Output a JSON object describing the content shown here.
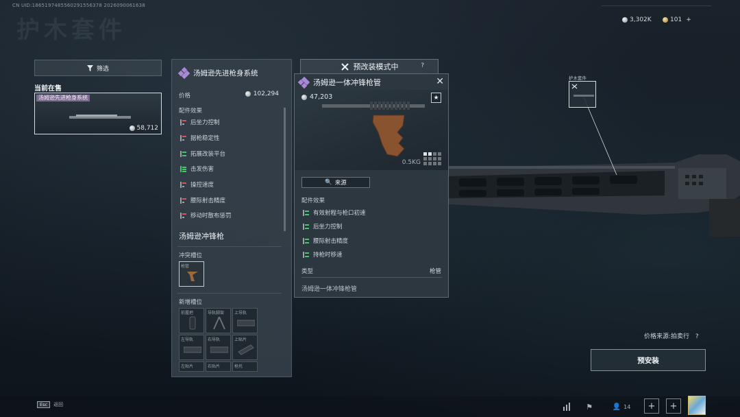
{
  "header": {
    "uid": "CN UID:1865197485560291556378  2026090061638",
    "page_title": "护木套件",
    "currency_silver": "3,302K",
    "currency_gold": "101",
    "currency_add": "+"
  },
  "left": {
    "filter_label": "筛选",
    "current_on_sale": "当前在售",
    "card_name": "汤姆逊先进枪身系统",
    "card_price": "58,712"
  },
  "panel1": {
    "title": "汤姆逊先进枪身系统",
    "price_label": "价格",
    "price_value": "102,294",
    "effects_label": "配件效果",
    "effects": [
      {
        "label": "后坐力控制",
        "dir": "down"
      },
      {
        "label": "据枪稳定性",
        "dir": "down"
      },
      {
        "label": "拓展改装平台",
        "dir": "up"
      },
      {
        "label": "击发伤害",
        "dir": "up"
      },
      {
        "label": "操控速度",
        "dir": "down"
      },
      {
        "label": "腰际射击精度",
        "dir": "down"
      },
      {
        "label": "移动时散布惩罚",
        "dir": "down"
      }
    ],
    "weapon_name": "汤姆逊冲锋枪",
    "conflict_label": "冲突槽位",
    "conflict_slot": "枪管",
    "new_slots_label": "新增槽位",
    "new_slots": [
      "前握把",
      "导轨脚架",
      "上导轨",
      "左导轨",
      "右导轨",
      "上贴片",
      "左贴片",
      "右贴片",
      "枪托"
    ]
  },
  "mode_button": {
    "label": "预改装模式中",
    "help": "?"
  },
  "panel2": {
    "title": "汤姆逊一体冲锋枪管",
    "price": "47,203",
    "weight": "0.5KG",
    "source_button": "来源",
    "effects_label": "配件效果",
    "effects": [
      {
        "label": "有效射程与枪口初速",
        "dir": "up"
      },
      {
        "label": "后坐力控制",
        "dir": "up"
      },
      {
        "label": "腰际射击精度",
        "dir": "up"
      },
      {
        "label": "持枪时移速",
        "dir": "up"
      }
    ],
    "type_label": "类型",
    "type_value": "枪管",
    "description": "汤姆逊一体冲锋枪管"
  },
  "preview": {
    "label": "护木套件"
  },
  "actions": {
    "price_source": "价格来源:拍卖行",
    "price_source_help": "?",
    "preinstall": "预安装"
  },
  "bottom": {
    "esc_key": "Esc",
    "back_label": "返回",
    "friends_count": "14"
  },
  "colors": {
    "up": "#4bc46e",
    "down": "#d35a54",
    "rarity_purple": "#a989d6"
  }
}
